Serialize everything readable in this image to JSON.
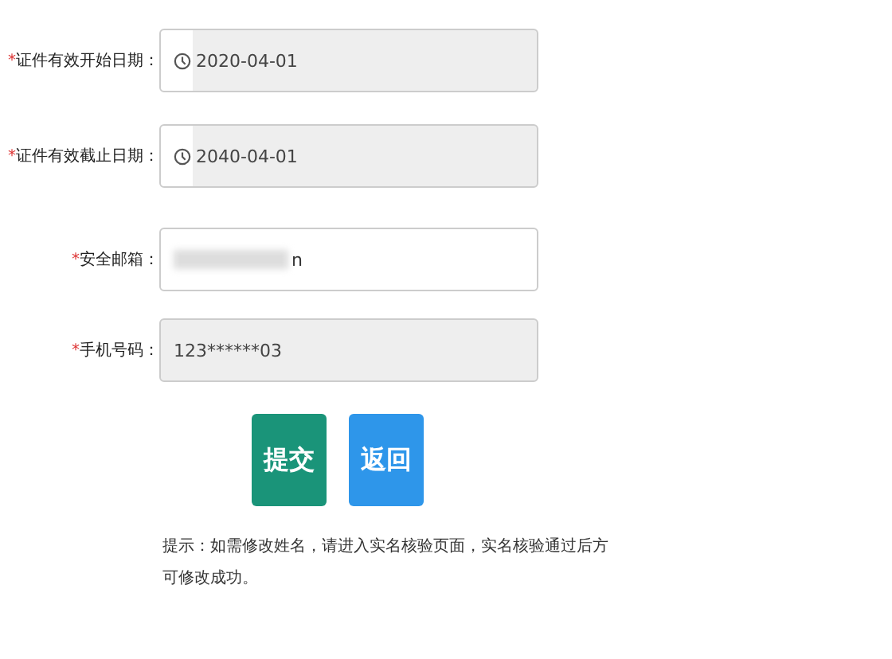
{
  "fields": [
    {
      "label": "证件有效开始日期：",
      "marker": "*",
      "kind": "date",
      "value": "2020-04-01",
      "disabled": true
    },
    {
      "label": "证件有效截止日期：",
      "marker": "*",
      "kind": "date",
      "value": "2040-04-01",
      "disabled": true
    },
    {
      "label": "安全邮箱：",
      "marker": "*",
      "kind": "redacted",
      "value": "n",
      "disabled": false
    },
    {
      "label": "手机号码：",
      "marker": "*",
      "kind": "text",
      "value": "123******03",
      "disabled": true
    }
  ],
  "buttons": [
    {
      "label": "提交",
      "kind": "primary"
    },
    {
      "label": "返回",
      "kind": "secondary"
    }
  ],
  "hint": [
    "提示：如需修改姓名，请进入实名核验页面，实名核验通过后方",
    "可修改成功。"
  ]
}
